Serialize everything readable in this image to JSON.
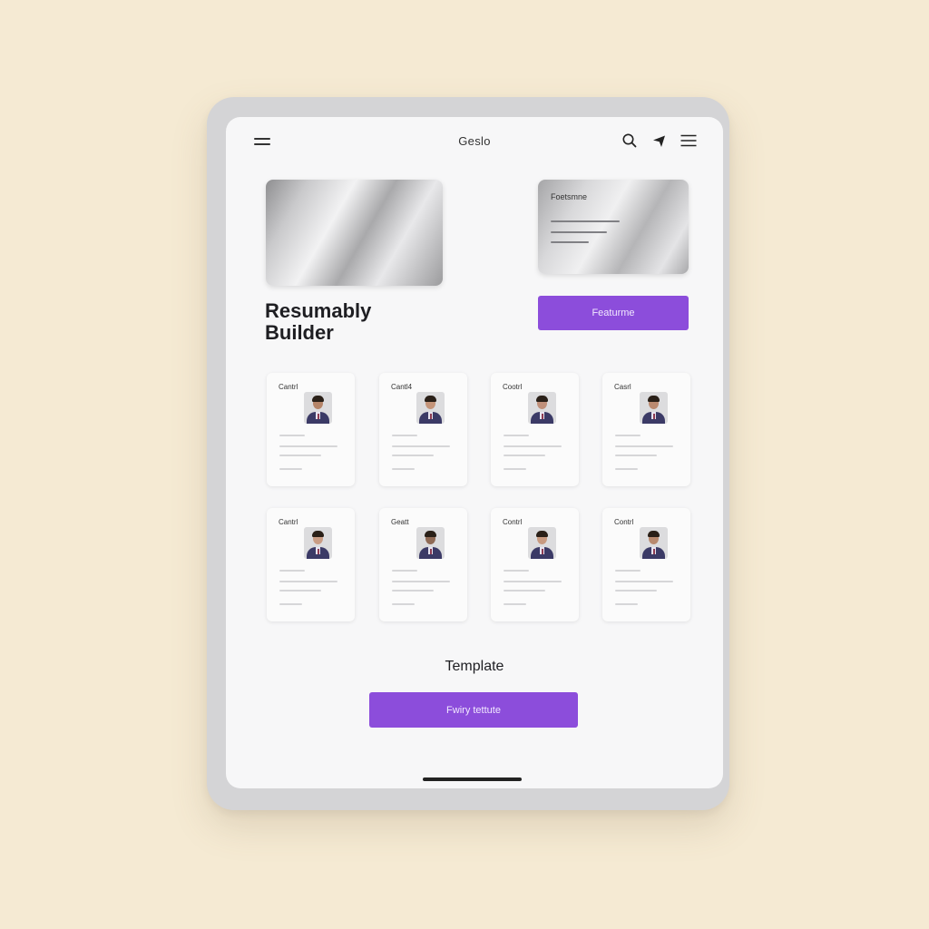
{
  "header": {
    "title": "Geslo",
    "icons": [
      "hamburger-menu-icon",
      "search-icon",
      "send-icon",
      "menu-icon"
    ]
  },
  "hero": {
    "title": "Resumably\nBuilder"
  },
  "feature": {
    "card_title": "Foetsmne",
    "button_label": "Featurme"
  },
  "templates": [
    {
      "title": "Cantrl"
    },
    {
      "title": "Cantl4"
    },
    {
      "title": "Cootrl"
    },
    {
      "title": "Casrl"
    },
    {
      "title": "Cantrl"
    },
    {
      "title": "Geatt"
    },
    {
      "title": "Contrl"
    },
    {
      "title": "Contrl"
    }
  ],
  "section": {
    "title": "Template"
  },
  "cta": {
    "label": "Fwiry tettute"
  },
  "colors": {
    "background": "#f5ead3",
    "accent": "#8c4ddb",
    "screen": "#f7f7f8"
  }
}
